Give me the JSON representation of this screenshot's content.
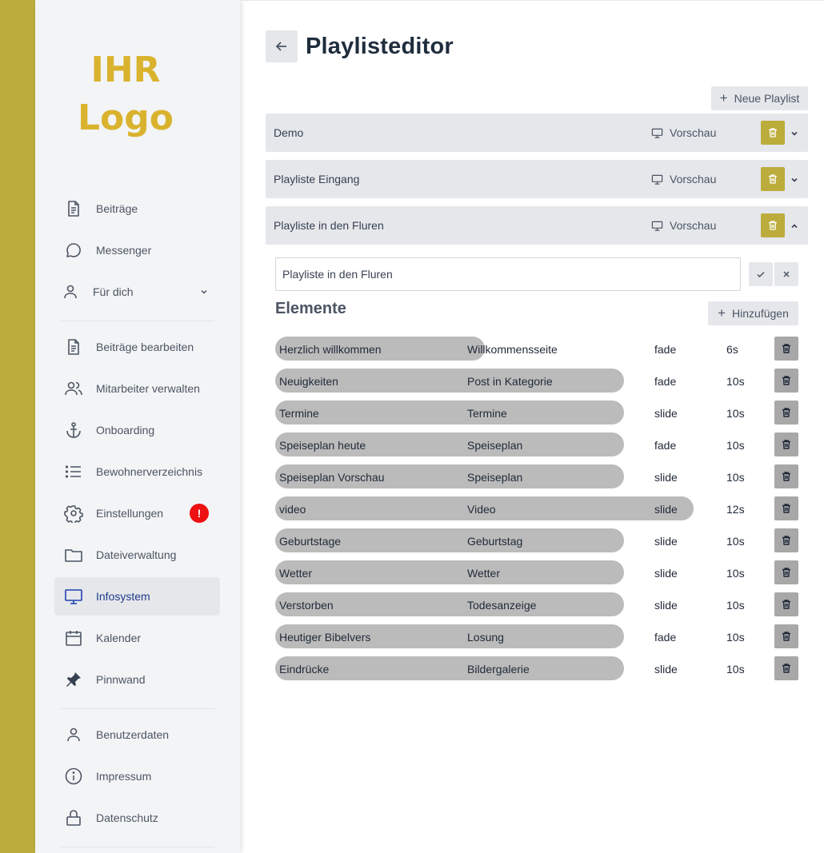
{
  "colors": {
    "accent": "#bcac3c",
    "logo": "#dab32e",
    "sidebar_bg": "#f3f4f6",
    "active_text": "#1e3a8a",
    "badge": "#ee1111",
    "element_bar": "#bbbbbb"
  },
  "logo": {
    "line1": "IHR",
    "line2": "Logo"
  },
  "sidebar": {
    "items": [
      {
        "label": "Beiträge",
        "icon": "document-icon"
      },
      {
        "label": "Messenger",
        "icon": "chat-icon"
      },
      {
        "label": "Für dich",
        "icon": "user-icon"
      },
      {
        "label": "Beiträge bearbeiten",
        "icon": "document-icon"
      },
      {
        "label": "Mitarbeiter verwalten",
        "icon": "users-icon"
      },
      {
        "label": "Onboarding",
        "icon": "anchor-icon"
      },
      {
        "label": "Bewohnerverzeichnis",
        "icon": "list-icon"
      },
      {
        "label": "Einstellungen",
        "icon": "gear-icon",
        "badge": "!"
      },
      {
        "label": "Dateiverwaltung",
        "icon": "folder-icon"
      },
      {
        "label": "Infosystem",
        "icon": "monitor-icon",
        "active": true
      },
      {
        "label": "Kalender",
        "icon": "calendar-icon"
      },
      {
        "label": "Pinnwand",
        "icon": "pin-icon"
      },
      {
        "label": "Benutzerdaten",
        "icon": "user-icon"
      },
      {
        "label": "Impressum",
        "icon": "info-icon"
      },
      {
        "label": "Datenschutz",
        "icon": "lock-icon"
      }
    ]
  },
  "header": {
    "title": "Playlisteditor",
    "back_icon": "arrow-left-icon"
  },
  "new_playlist_label": "Neue Playlist",
  "playlists": [
    {
      "name": "Demo",
      "preview_label": "Vorschau",
      "expanded": false
    },
    {
      "name": "Playliste Eingang",
      "preview_label": "Vorschau",
      "expanded": false
    },
    {
      "name": "Playliste in den Fluren",
      "preview_label": "Vorschau",
      "expanded": true
    }
  ],
  "editor": {
    "name_value": "Playliste in den Fluren",
    "elements_title": "Elemente",
    "add_label": "Hinzufügen",
    "elements": [
      {
        "name": "Herzlich willkommen",
        "type": "Willkommensseite",
        "transition": "fade",
        "duration": "6s"
      },
      {
        "name": "Neuigkeiten",
        "type": "Post in Kategorie",
        "transition": "fade",
        "duration": "10s"
      },
      {
        "name": "Termine",
        "type": "Termine",
        "transition": "slide",
        "duration": "10s"
      },
      {
        "name": "Speiseplan heute",
        "type": "Speiseplan",
        "transition": "fade",
        "duration": "10s"
      },
      {
        "name": "Speiseplan Vorschau",
        "type": "Speiseplan",
        "transition": "slide",
        "duration": "10s"
      },
      {
        "name": "video",
        "type": "Video",
        "transition": "slide",
        "duration": "12s"
      },
      {
        "name": "Geburtstage",
        "type": "Geburtstag",
        "transition": "slide",
        "duration": "10s"
      },
      {
        "name": "Wetter",
        "type": "Wetter",
        "transition": "slide",
        "duration": "10s"
      },
      {
        "name": "Verstorben",
        "type": "Todesanzeige",
        "transition": "slide",
        "duration": "10s"
      },
      {
        "name": "Heutiger Bibelvers",
        "type": "Losung",
        "transition": "fade",
        "duration": "10s"
      },
      {
        "name": "Eindrücke",
        "type": "Bildergalerie",
        "transition": "slide",
        "duration": "10s"
      }
    ]
  }
}
